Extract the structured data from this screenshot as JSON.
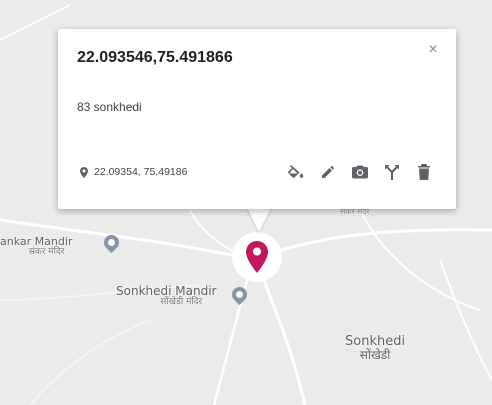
{
  "map": {
    "places": [
      {
        "name": "ankar Mandir",
        "sub": "संकर मंदिर"
      },
      {
        "name": "Sonkhedi Mandir",
        "sub": "सोंखेडी मंदिर"
      },
      {
        "name": "Sonkhedi",
        "sub": "सोंखेडी"
      }
    ],
    "partial_label": "संकर मंदर",
    "colors": {
      "land": "#ebebe9",
      "road": "#ffffff",
      "marker": "#c2185b",
      "poi": "#7f97a8"
    }
  },
  "info_window": {
    "title": "22.093546,75.491866",
    "address": "83 sonkhedi",
    "coordinates": "22.09354, 75.49186",
    "close_symbol": "×",
    "tools": [
      {
        "name": "fill-color-icon"
      },
      {
        "name": "edit-icon"
      },
      {
        "name": "camera-icon"
      },
      {
        "name": "directions-icon"
      },
      {
        "name": "delete-icon"
      }
    ]
  }
}
